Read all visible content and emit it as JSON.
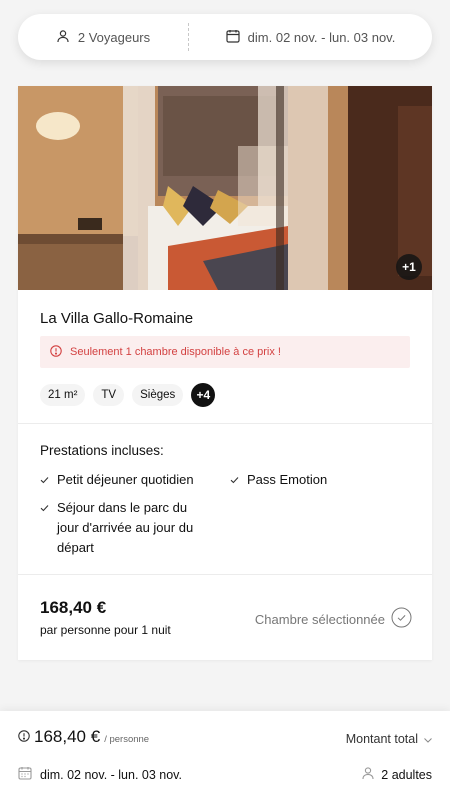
{
  "search": {
    "guests": "2 Voyageurs",
    "dates": "dim. 02 nov. - lun. 03 nov."
  },
  "room": {
    "photo_more": "+1",
    "name": "La Villa Gallo-Romaine",
    "alert": "Seulement 1 chambre disponible à ce prix !",
    "amenities": [
      "21 m²",
      "TV",
      "Sièges"
    ],
    "amenities_more": "+4",
    "services_title": "Prestations incluses:",
    "services": [
      "Petit déjeuner quotidien",
      "Pass Emotion",
      "Séjour dans le parc du jour d'arrivée au jour du départ"
    ],
    "price": "168,40 €",
    "price_note": "par personne pour 1 nuit",
    "selected_label": "Chambre sélectionnée"
  },
  "footer": {
    "price": "168,40 €",
    "per": "/ personne",
    "total_label": "Montant total",
    "dates": "dim. 02 nov. - lun. 03 nov.",
    "guests": "2 adultes"
  },
  "colors": {
    "alert_text": "#d34141",
    "alert_bg": "#fbeeee",
    "text": "#111111"
  },
  "icons": [
    "user-icon",
    "calendar-icon",
    "alert-circle-icon",
    "check-icon",
    "check-circle-icon",
    "chevron-down-icon"
  ]
}
